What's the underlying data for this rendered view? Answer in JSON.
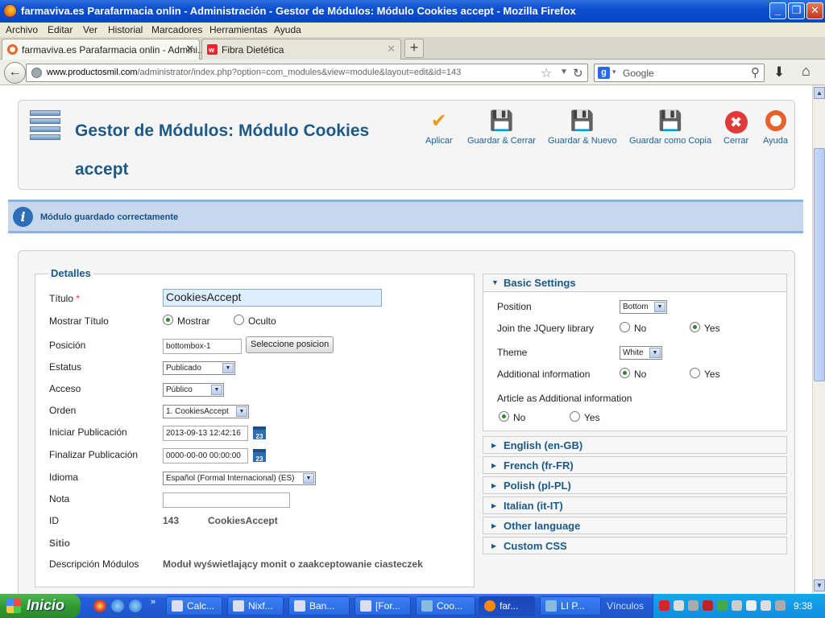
{
  "window": {
    "title": "farmaviva.es Parafarmacia onlin - Administración - Gestor de Módulos: Módulo Cookies accept - Mozilla Firefox",
    "minimize": "_",
    "maximize": "❐",
    "close": "✕"
  },
  "menu": [
    "Archivo",
    "Editar",
    "Ver",
    "Historial",
    "Marcadores",
    "Herramientas",
    "Ayuda"
  ],
  "tabs": [
    {
      "label": "farmaviva.es Parafarmacia onlin - Admini...",
      "close": "✕",
      "active": true
    },
    {
      "label": "Fibra Dietética",
      "close": "✕",
      "active": false
    }
  ],
  "new_tab": "+",
  "url": {
    "host": "www.productosmil.com",
    "path": "/administrator/index.php?option=com_modules&view=module&layout=edit&id=143"
  },
  "search": {
    "engine_letter": "g",
    "placeholder": "Google"
  },
  "page": {
    "title": "Gestor de Módulos: Módulo Cookies accept",
    "toolbar": [
      {
        "label": "Aplicar",
        "icon": "check-icon"
      },
      {
        "label": "Guardar & Cerrar",
        "icon": "floppy-icon"
      },
      {
        "label": "Guardar & Nuevo",
        "icon": "floppy-plus-icon"
      },
      {
        "label": "Guardar como Copia",
        "icon": "floppy-copy-icon"
      },
      {
        "label": "Cerrar",
        "icon": "close-circle-icon"
      },
      {
        "label": "Ayuda",
        "icon": "lifebuoy-icon"
      }
    ],
    "message": "Módulo guardado correctamente",
    "details": {
      "legend": "Detalles",
      "titulo_label": "Título",
      "titulo_req": "*",
      "titulo_value": "CookiesAccept",
      "mostrar_titulo_label": "Mostrar Título",
      "mostrar_opt": "Mostrar",
      "oculto_opt": "Oculto",
      "posicion_label": "Posición",
      "posicion_value": "bottombox-1",
      "seleccione_button": "Seleccione posicion",
      "estatus_label": "Estatus",
      "estatus_value": "Publicado",
      "acceso_label": "Acceso",
      "acceso_value": "Público",
      "orden_label": "Orden",
      "orden_value": "1. CookiesAccept",
      "iniciar_label": "Iniciar Publicación",
      "iniciar_value": "2013-09-13 12:42:16",
      "finalizar_label": "Finalizar Publicación",
      "finalizar_value": "0000-00-00 00:00:00",
      "cal_text": "23",
      "idioma_label": "Idioma",
      "idioma_value": "Español (Formal Internacional) (ES)",
      "nota_label": "Nota",
      "nota_value": "",
      "id_label": "ID",
      "id_value": "143",
      "id_name": "CookiesAccept",
      "sitio_label": "Sitio",
      "descripcion_label": "Descripción Módulos",
      "descripcion_value": "Moduł wyświetlający monit o zaakceptowanie ciasteczek"
    },
    "basic": {
      "header": "Basic Settings",
      "position_label": "Position",
      "position_value": "Bottom",
      "jquery_label": "Join the JQuery library",
      "no": "No",
      "yes": "Yes",
      "theme_label": "Theme",
      "theme_value": "White",
      "additional_label": "Additional information",
      "article_label": "Article as Additional information"
    },
    "sections": [
      "English (en-GB)",
      "French (fr-FR)",
      "Polish (pl-PL)",
      "Italian (it-IT)",
      "Other language",
      "Custom CSS"
    ]
  },
  "taskbar": {
    "start": "Inicio",
    "tasks": [
      "Calc...",
      "Nixf...",
      "Ban...",
      "[For...",
      "Coo...",
      "far...",
      "LI P..."
    ],
    "vinculos": "Vínculos",
    "clock": "9:38"
  },
  "colors": {
    "accent": "#1a5a8a",
    "title_bar": "#0a4fd0",
    "message_bg": "#c7d8ec"
  }
}
